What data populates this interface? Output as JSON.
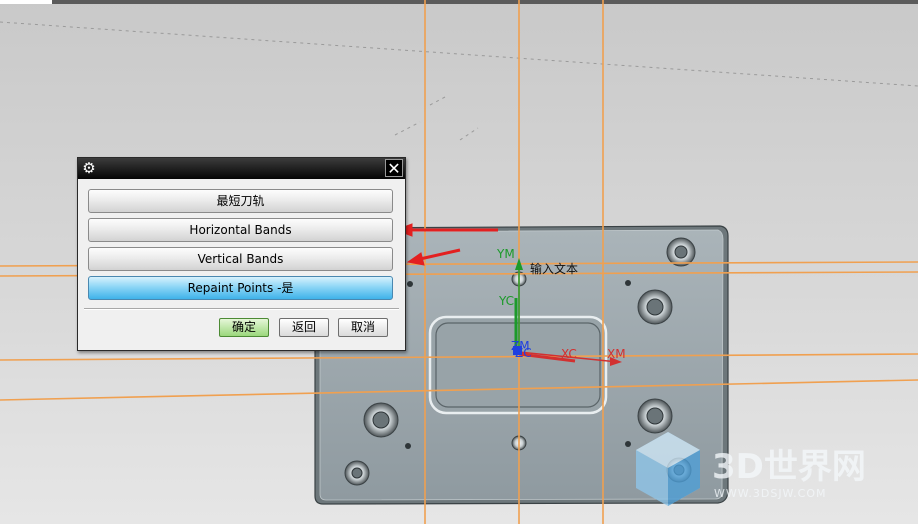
{
  "dialog": {
    "buttons": [
      {
        "label": "最短刀轨"
      },
      {
        "label": "Horizontal Bands"
      },
      {
        "label": "Vertical Bands"
      },
      {
        "label": "Repaint Points -是"
      }
    ],
    "ok_label": "确定",
    "back_label": "返回",
    "cancel_label": "取消"
  },
  "viewport": {
    "axes": {
      "ym": "YM",
      "yc": "YC",
      "xc": "XC",
      "xm": "XM",
      "zm": "ZM",
      "zc": "ZC"
    },
    "note": "输入文本"
  },
  "watermark": {
    "text": "3D世界网",
    "url": "WWW.3DSJW.COM"
  },
  "colors": {
    "guide_lines": "#f0a050",
    "arrow": "#e32020",
    "y_axis": "#1c9a2a",
    "x_axis": "#d23030",
    "z_axis": "#2040e0"
  }
}
